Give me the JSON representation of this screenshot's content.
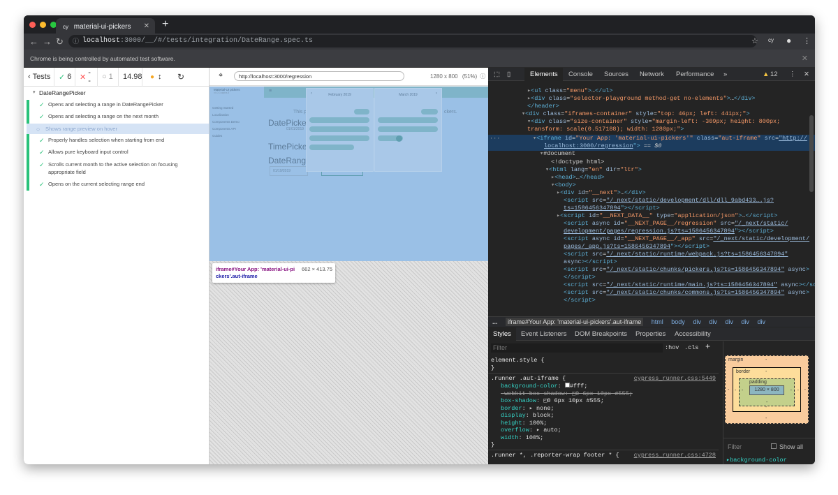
{
  "browser": {
    "tab_title": "material-ui-pickers",
    "url_host": "localhost",
    "url_rest": ":3000/__/#/tests/integration/DateRange.spec.ts",
    "infobar_text": "Chrome is being controlled by automated test software."
  },
  "reporter": {
    "back_label": "Tests",
    "passed": "6",
    "failed": "--",
    "pending": "1",
    "duration": "14.98",
    "suite_title": "DateRangePicker",
    "tests": [
      {
        "label": "Opens and selecting a range in DateRangePicker",
        "state": "passed"
      },
      {
        "label": "Opens and selecting a range on the next month",
        "state": "passed"
      },
      {
        "label": "Shows range preview on hover",
        "state": "pending"
      },
      {
        "label": "Properly handles selection when starting from end",
        "state": "passed"
      },
      {
        "label": "Allows pure keyboard input control",
        "state": "passed"
      },
      {
        "label": "Scrolls current month to the active selection on focusing",
        "state": "passed"
      },
      {
        "label": "appropriate field",
        "state": "continuation"
      },
      {
        "label": "Opens on the current selecting range end",
        "state": "passed"
      }
    ]
  },
  "aut": {
    "url": "http://localhost:3000/regression",
    "viewport": "1280 x 800",
    "scale": "(51%)",
    "tooltip_main": "iframe#Your App: 'material-ui-pi",
    "tooltip_line2": "ckers'.aut-iframe",
    "tooltip_dims": "662 × 413.75",
    "app": {
      "brand": "Material-UI pickers",
      "version": "v4.0.0-alpha.5",
      "nav": [
        "Getting Started",
        "Localization",
        "Components Demo",
        "Components API",
        "Guides"
      ],
      "months": [
        "February 2019",
        "March 2019"
      ],
      "headings": [
        "DatePicker",
        "TimePicker",
        "DateRangeP"
      ],
      "dates": [
        "01/01/2019",
        "01/19/2019",
        "01/19/2019"
      ],
      "side_text": "This p",
      "side_text2": "ckers."
    }
  },
  "devtools": {
    "tabs": [
      "Elements",
      "Console",
      "Sources",
      "Network",
      "Performance"
    ],
    "warnings": "12",
    "breadcrumb": [
      "iframe#Your App: 'material-ui-pickers'.aut-iframe",
      "html",
      "body",
      "div",
      "div",
      "div",
      "div",
      "div"
    ],
    "style_tabs": [
      "Styles",
      "Event Listeners",
      "DOM Breakpoints",
      "Properties",
      "Accessibility"
    ],
    "filter_placeholder": "Filter",
    "hov": ":hov",
    "cls": ".cls",
    "element_style": "element.style {",
    "rule1_selector": ".runner .aut-iframe {",
    "rule1_source": "cypress_runner.css:5449",
    "rule1_props": [
      {
        "name": "background-color",
        "value": "#fff;"
      },
      {
        "name": "-webkit-box-shadow",
        "value": "0 6px 10px #555;"
      },
      {
        "name": "box-shadow",
        "value": "0 6px 10px #555;"
      },
      {
        "name": "border",
        "value": "none;"
      },
      {
        "name": "display",
        "value": "block;"
      },
      {
        "name": "height",
        "value": "100%;"
      },
      {
        "name": "overflow",
        "value": "auto;"
      },
      {
        "name": "width",
        "value": "100%;"
      }
    ],
    "rule2_selector": ".runner *, .reporter-wrap footer * {",
    "rule2_source": "cypress_runner.css:4728",
    "box": {
      "margin": "margin",
      "border": "border",
      "padding": "padding",
      "content": "1280 × 800",
      "dash": "-"
    },
    "filter2": "Filter",
    "show_all": "Show all",
    "computed_first": "background-color"
  },
  "colors": {
    "pass": "#2ac27a",
    "fail": "#ff5252",
    "accent": "#5db0d7"
  }
}
